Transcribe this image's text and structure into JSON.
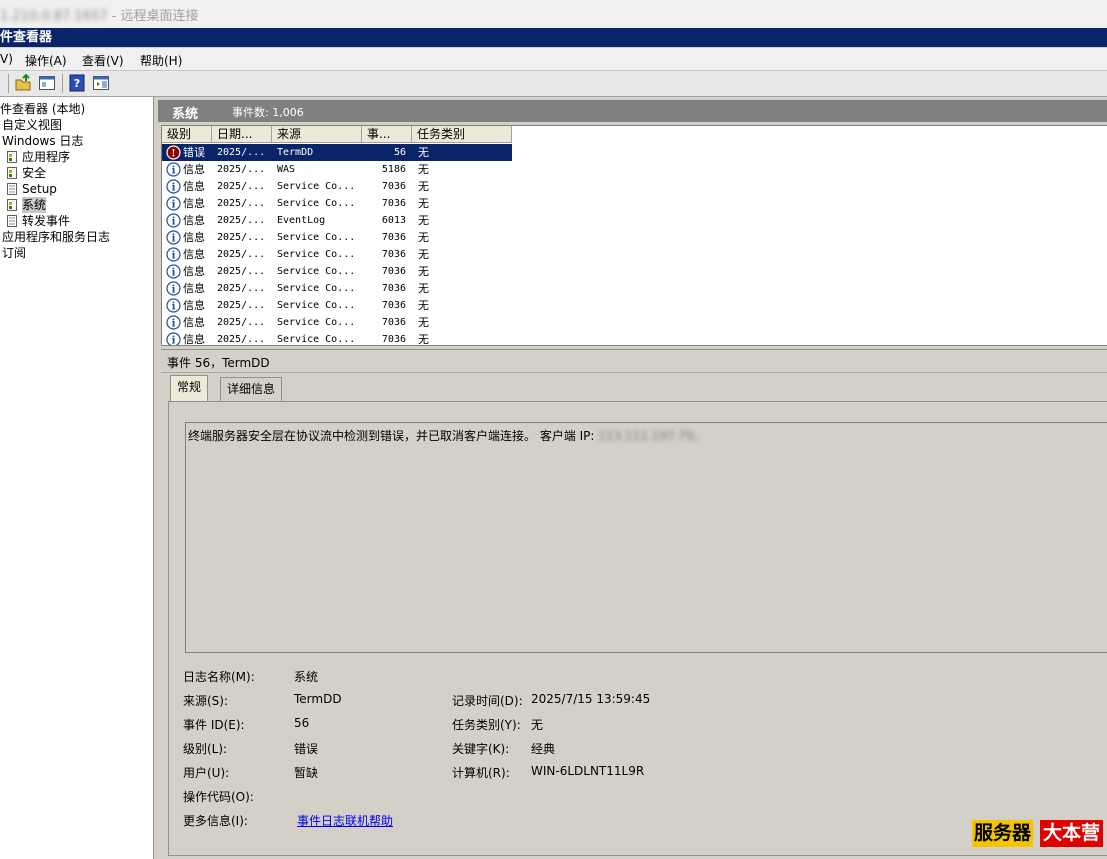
{
  "rdp": {
    "title_blurred": "1.210.0.87.1657",
    "title": " - 远程桌面连接"
  },
  "app": {
    "title": "件查看器"
  },
  "menu": {
    "items": [
      "V)",
      "操作(A)",
      "查看(V)",
      "帮助(H)"
    ]
  },
  "tree": {
    "items": [
      {
        "label": "件查看器 (本地)",
        "icon": "none"
      },
      {
        "label": "自定义视图",
        "icon": "none"
      },
      {
        "label": "Windows 日志",
        "icon": "none"
      },
      {
        "label": "应用程序",
        "icon": "log-icon"
      },
      {
        "label": "安全",
        "icon": "log-icon"
      },
      {
        "label": "Setup",
        "icon": "page-icon"
      },
      {
        "label": "系统",
        "icon": "log-icon"
      },
      {
        "label": "转发事件",
        "icon": "page-icon"
      },
      {
        "label": "应用程序和服务日志",
        "icon": "none"
      },
      {
        "label": "订阅",
        "icon": "none"
      }
    ],
    "selected": "系统"
  },
  "panel": {
    "title": "系统",
    "count": "事件数: 1,006"
  },
  "list": {
    "columns": [
      "级别",
      "日期...",
      "来源",
      "事...",
      "任务类别"
    ],
    "rows": [
      {
        "level": "错误",
        "date": "2025/...",
        "source": "TermDD",
        "id": "56",
        "task": "无",
        "kind": "error"
      },
      {
        "level": "信息",
        "date": "2025/...",
        "source": "WAS",
        "id": "5186",
        "task": "无",
        "kind": "info"
      },
      {
        "level": "信息",
        "date": "2025/...",
        "source": "Service Co...",
        "id": "7036",
        "task": "无",
        "kind": "info"
      },
      {
        "level": "信息",
        "date": "2025/...",
        "source": "Service Co...",
        "id": "7036",
        "task": "无",
        "kind": "info"
      },
      {
        "level": "信息",
        "date": "2025/...",
        "source": "EventLog",
        "id": "6013",
        "task": "无",
        "kind": "info"
      },
      {
        "level": "信息",
        "date": "2025/...",
        "source": "Service Co...",
        "id": "7036",
        "task": "无",
        "kind": "info"
      },
      {
        "level": "信息",
        "date": "2025/...",
        "source": "Service Co...",
        "id": "7036",
        "task": "无",
        "kind": "info"
      },
      {
        "level": "信息",
        "date": "2025/...",
        "source": "Service Co...",
        "id": "7036",
        "task": "无",
        "kind": "info"
      },
      {
        "level": "信息",
        "date": "2025/...",
        "source": "Service Co...",
        "id": "7036",
        "task": "无",
        "kind": "info"
      },
      {
        "level": "信息",
        "date": "2025/...",
        "source": "Service Co...",
        "id": "7036",
        "task": "无",
        "kind": "info"
      },
      {
        "level": "信息",
        "date": "2025/...",
        "source": "Service Co...",
        "id": "7036",
        "task": "无",
        "kind": "info"
      },
      {
        "level": "信息",
        "date": "2025/...",
        "source": "Service Co...",
        "id": "7036",
        "task": "无",
        "kind": "info"
      }
    ]
  },
  "detail": {
    "header": "事件 56，TermDD",
    "tabs": [
      "常规",
      "详细信息"
    ],
    "message": "终端服务器安全层在协议流中检测到错误，并已取消客户端连接。 客户端 IP: ",
    "message_ip_blurred": "113.111.197.79。",
    "fields_left": [
      {
        "label": "日志名称(M):",
        "value": "系统"
      },
      {
        "label": "来源(S):",
        "value": "TermDD"
      },
      {
        "label": "事件 ID(E):",
        "value": "56"
      },
      {
        "label": "级别(L):",
        "value": "错误"
      },
      {
        "label": "用户(U):",
        "value": "暂缺"
      },
      {
        "label": "操作代码(O):",
        "value": ""
      },
      {
        "label": "更多信息(I):",
        "value": "事件日志联机帮助"
      }
    ],
    "fields_right": [
      {
        "label": "记录时间(D):",
        "value": "2025/7/15 13:59:45"
      },
      {
        "label": "任务类别(Y):",
        "value": "无"
      },
      {
        "label": "关键字(K):",
        "value": "经典"
      },
      {
        "label": "计算机(R):",
        "value": "WIN-6LDLNT11L9R"
      }
    ]
  },
  "watermark": {
    "part1": "服务器",
    "part2": "大本营"
  },
  "colors": {
    "titlebar": "#0a246a",
    "selection": "#0a246a",
    "error_icon": "#8b0000",
    "info_icon": "#1f4e9a",
    "link": "#0000ee"
  }
}
